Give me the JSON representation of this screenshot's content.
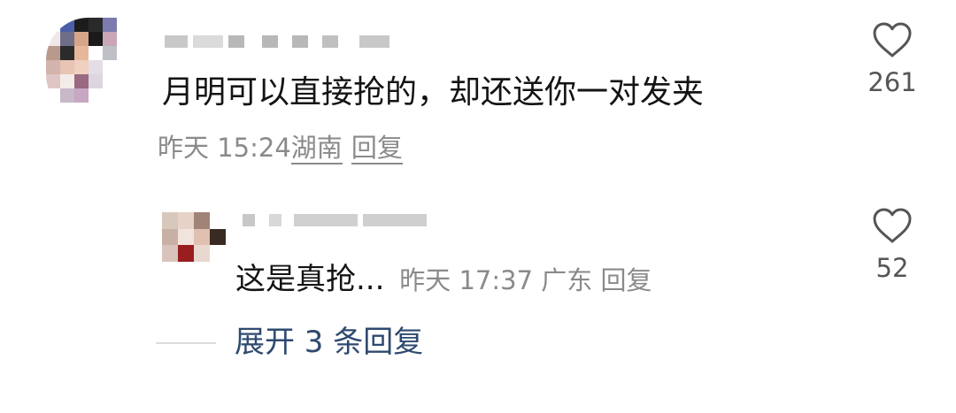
{
  "main_comment": {
    "text": "月明可以直接抢的，却还送你一对发夹",
    "time": "昨天 15:24",
    "location": "湖南",
    "reply_label": "回复",
    "like_count": "261",
    "like_icon": "heart-outline-icon"
  },
  "reply_comment": {
    "text": "这是真抢...",
    "time": "昨天 17:37",
    "location": "广东",
    "reply_label": "回复",
    "like_count": "52",
    "like_icon": "heart-outline-icon"
  },
  "expand_replies": {
    "label": "展开 3 条回复"
  },
  "colors": {
    "text": "#141414",
    "meta": "#8a8a8a",
    "link": "#2e4a6f"
  }
}
